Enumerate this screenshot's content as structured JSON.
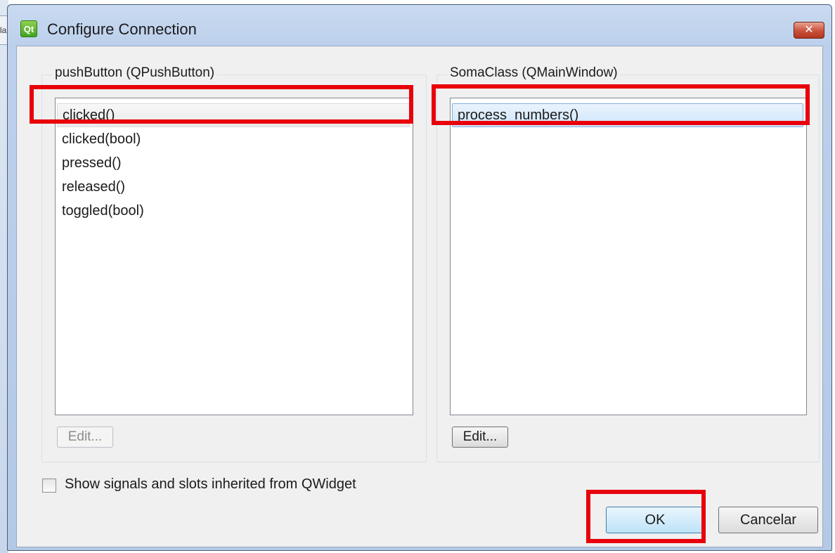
{
  "background": {
    "tab_text": "la"
  },
  "dialog": {
    "title": "Configure Connection",
    "icon": "qt-designer-icon",
    "close_label": "✕"
  },
  "left_group": {
    "label": "pushButton (QPushButton)",
    "items": [
      "clicked()",
      "clicked(bool)",
      "pressed()",
      "released()",
      "toggled(bool)"
    ],
    "selected_index": 0,
    "edit_label": "Edit...",
    "edit_enabled": false
  },
  "right_group": {
    "label": "SomaClass (QMainWindow)",
    "items": [
      "process_numbers()"
    ],
    "selected_index": 0,
    "edit_label": "Edit...",
    "edit_enabled": true
  },
  "inherit_checkbox": {
    "label": "Show signals and slots inherited from QWidget",
    "checked": false
  },
  "buttons": {
    "ok": "OK",
    "cancel": "Cancelar"
  },
  "colors": {
    "highlight": "#e8000b",
    "titlebar": "#bcd0ec",
    "dialog_bg": "#f0f0f0"
  }
}
